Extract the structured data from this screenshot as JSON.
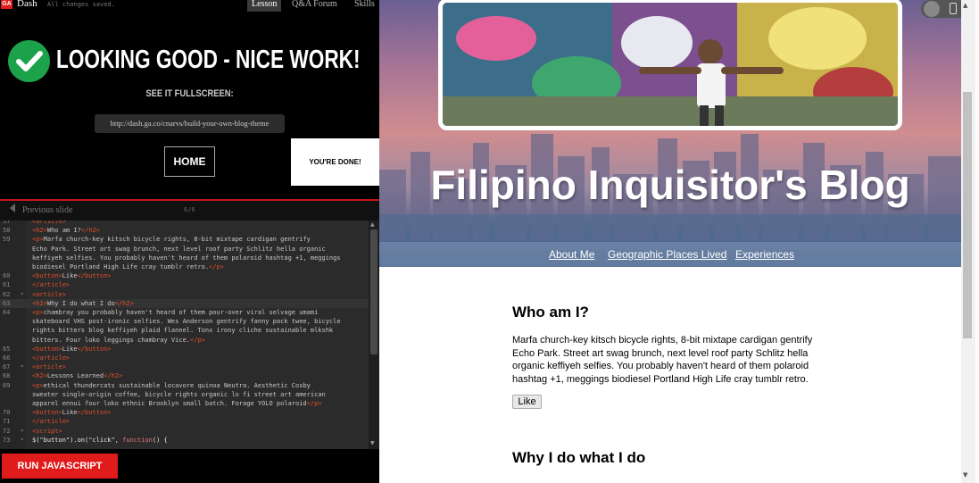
{
  "header": {
    "logo_text": "GA",
    "app_name": "Dash",
    "save_status": "All changes saved.",
    "tabs": [
      "Lesson",
      "Q&A Forum",
      "Skills"
    ]
  },
  "success": {
    "headline": "LOOKING GOOD - NICE WORK!",
    "see_fullscreen": "SEE IT FULLSCREEN:",
    "url": "http://dash.ga.co/cnarvs/build-your-own-blog-theme",
    "home_button": "HOME",
    "done_button": "YOU'RE DONE!"
  },
  "slide_nav": {
    "prev_label": "Previous slide",
    "counter": "6/6"
  },
  "editor": {
    "lines": [
      {
        "n": "57",
        "html": "<span class='t-tag'>&lt;article&gt;</span>"
      },
      {
        "n": "58",
        "html": "  <span class='t-tag'>&lt;h2&gt;</span>Who am I?<span class='t-tag'>&lt;/h2&gt;</span>"
      },
      {
        "n": "59",
        "html": "  <span class='t-tag'>&lt;p&gt;</span>Marfa church-key kitsch bicycle rights, 8-bit mixtape cardigan gentrify"
      },
      {
        "n": "",
        "html": "Echo Park. Street art swag brunch, next level roof party Schlitz hella organic"
      },
      {
        "n": "",
        "html": "keffiyeh selfies. You probably haven't heard of them polaroid hashtag +1, meggings"
      },
      {
        "n": "",
        "html": "biodiesel Portland High Life cray tumblr retro.<span class='t-tag'>&lt;/p&gt;</span>"
      },
      {
        "n": "60",
        "html": "  <span class='t-tag'>&lt;button&gt;</span>Like<span class='t-tag'>&lt;/button&gt;</span>"
      },
      {
        "n": "61",
        "html": "<span class='t-tag'>&lt;/article&gt;</span>"
      },
      {
        "n": "62",
        "fold": true,
        "html": "<span class='t-tag'>&lt;article&gt;</span>"
      },
      {
        "n": "63",
        "hl": true,
        "html": "  <span class='t-tag'>&lt;h2&gt;</span>Why I do what I do<span class='t-tag'>&lt;/h2&gt;</span>"
      },
      {
        "n": "64",
        "html": "  <span class='t-tag'>&lt;p&gt;</span>chambray you probably haven't heard of them pour-over viral selvage umami"
      },
      {
        "n": "",
        "html": "skateboard VHS post-ironic selfies. Wes Anderson gentrify fanny pack twee, bicycle"
      },
      {
        "n": "",
        "html": "rights bitters blog keffiyeh plaid flannel. Tonx irony cliche sustainable mlkshk"
      },
      {
        "n": "",
        "html": "bitters. Four loko leggings chambray Vice.<span class='t-tag'>&lt;/p&gt;</span>"
      },
      {
        "n": "65",
        "html": "  <span class='t-tag'>&lt;button&gt;</span>Like<span class='t-tag'>&lt;/button&gt;</span>"
      },
      {
        "n": "66",
        "html": "<span class='t-tag'>&lt;/article&gt;</span>"
      },
      {
        "n": "67",
        "fold": true,
        "html": "<span class='t-tag'>&lt;article&gt;</span>"
      },
      {
        "n": "68",
        "html": "  <span class='t-tag'>&lt;h2&gt;</span>Lessons Learned<span class='t-tag'>&lt;/h2&gt;</span>"
      },
      {
        "n": "69",
        "html": "  <span class='t-tag'>&lt;p&gt;</span>ethical thundercats sustainable locavore quinoa Neutra. Aesthetic Cosby"
      },
      {
        "n": "",
        "html": "sweater single-origin coffee, bicycle rights organic lo fi street art american"
      },
      {
        "n": "",
        "html": "apparel ennui four loko ethnic Brooklyn small batch. Forage YOLO polaroid<span class='t-tag'>&lt;/p&gt;</span>"
      },
      {
        "n": "70",
        "html": "  <span class='t-tag'>&lt;button&gt;</span>Like<span class='t-tag'>&lt;/button&gt;</span>"
      },
      {
        "n": "71",
        "html": "<span class='t-tag'>&lt;/article&gt;</span>"
      },
      {
        "n": "72",
        "fold": true,
        "html": "<span class='t-tag'>&lt;script&gt;</span>"
      },
      {
        "n": "73",
        "fold": true,
        "html": "  <span class='t-js'>$(\"button\").on(\"click\", </span><span class='t-str'>function</span><span class='t-js'>() {</span>"
      }
    ]
  },
  "run_button": "RUN JAVASCRIPT",
  "blog": {
    "title": "Filipino Inquisitor's Blog",
    "nav": [
      "About Me",
      "Geographic Places Lived",
      "Experiences"
    ],
    "articles": [
      {
        "heading": "Who am I?",
        "body": "Marfa church-key kitsch bicycle rights, 8-bit mixtape cardigan gentrify Echo Park. Street art swag brunch, next level roof party Schlitz hella organic keffiyeh selfies. You probably haven't heard of them polaroid hashtag +1, meggings biodiesel Portland High Life cray tumblr retro.",
        "like": "Like"
      },
      {
        "heading": "Why I do what I do"
      }
    ]
  },
  "colors": {
    "accent_red": "#e01b1b",
    "success_green": "#1ca24b"
  }
}
